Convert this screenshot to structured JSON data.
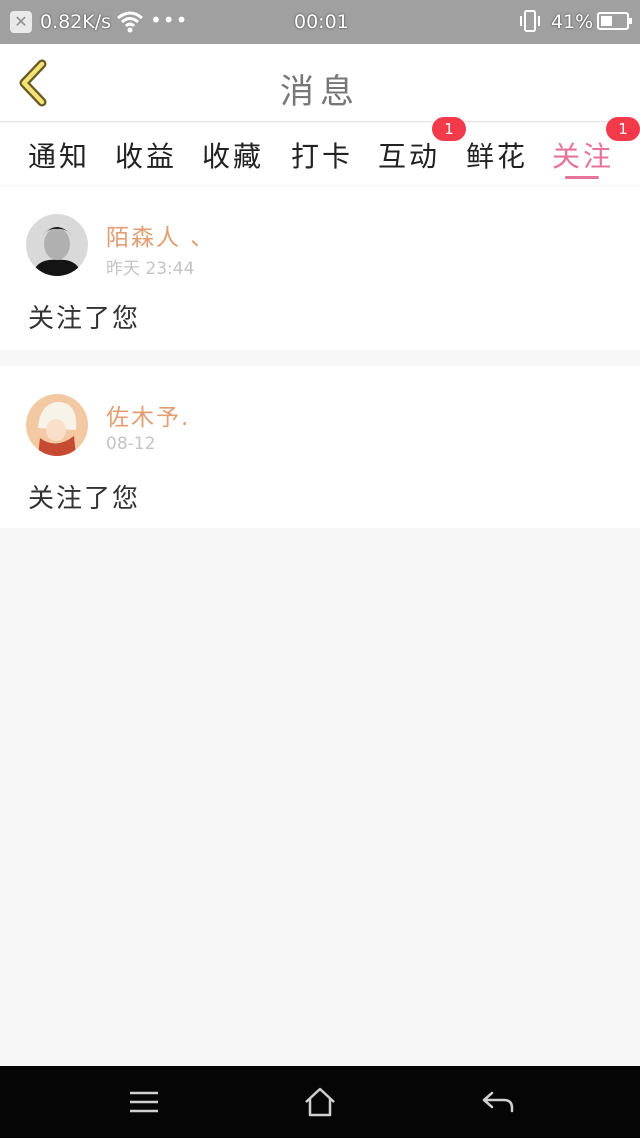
{
  "status_bar": {
    "close_symbol": "✕",
    "network_speed": "0.82K/s",
    "more_dots": "•••",
    "time": "00:01",
    "battery_percent": "41%"
  },
  "header": {
    "title": "消息"
  },
  "tabs": [
    {
      "label": "通知",
      "active": false
    },
    {
      "label": "收益",
      "active": false
    },
    {
      "label": "收藏",
      "active": false
    },
    {
      "label": "打卡",
      "active": false
    },
    {
      "label": "互动",
      "active": false,
      "badge": "1"
    },
    {
      "label": "鲜花",
      "active": false
    },
    {
      "label": "关注",
      "active": true,
      "badge": "1"
    }
  ],
  "notifications": [
    {
      "username": "陌森人 、",
      "time": "昨天 23:44",
      "message": "关注了您"
    },
    {
      "username": "佐木予.",
      "time": "08-12",
      "message": "关注了您"
    }
  ],
  "colors": {
    "accent": "#e6739a",
    "username": "#e29d72",
    "badge": "#f23a4a",
    "back_chevron": "#e9d96b"
  }
}
